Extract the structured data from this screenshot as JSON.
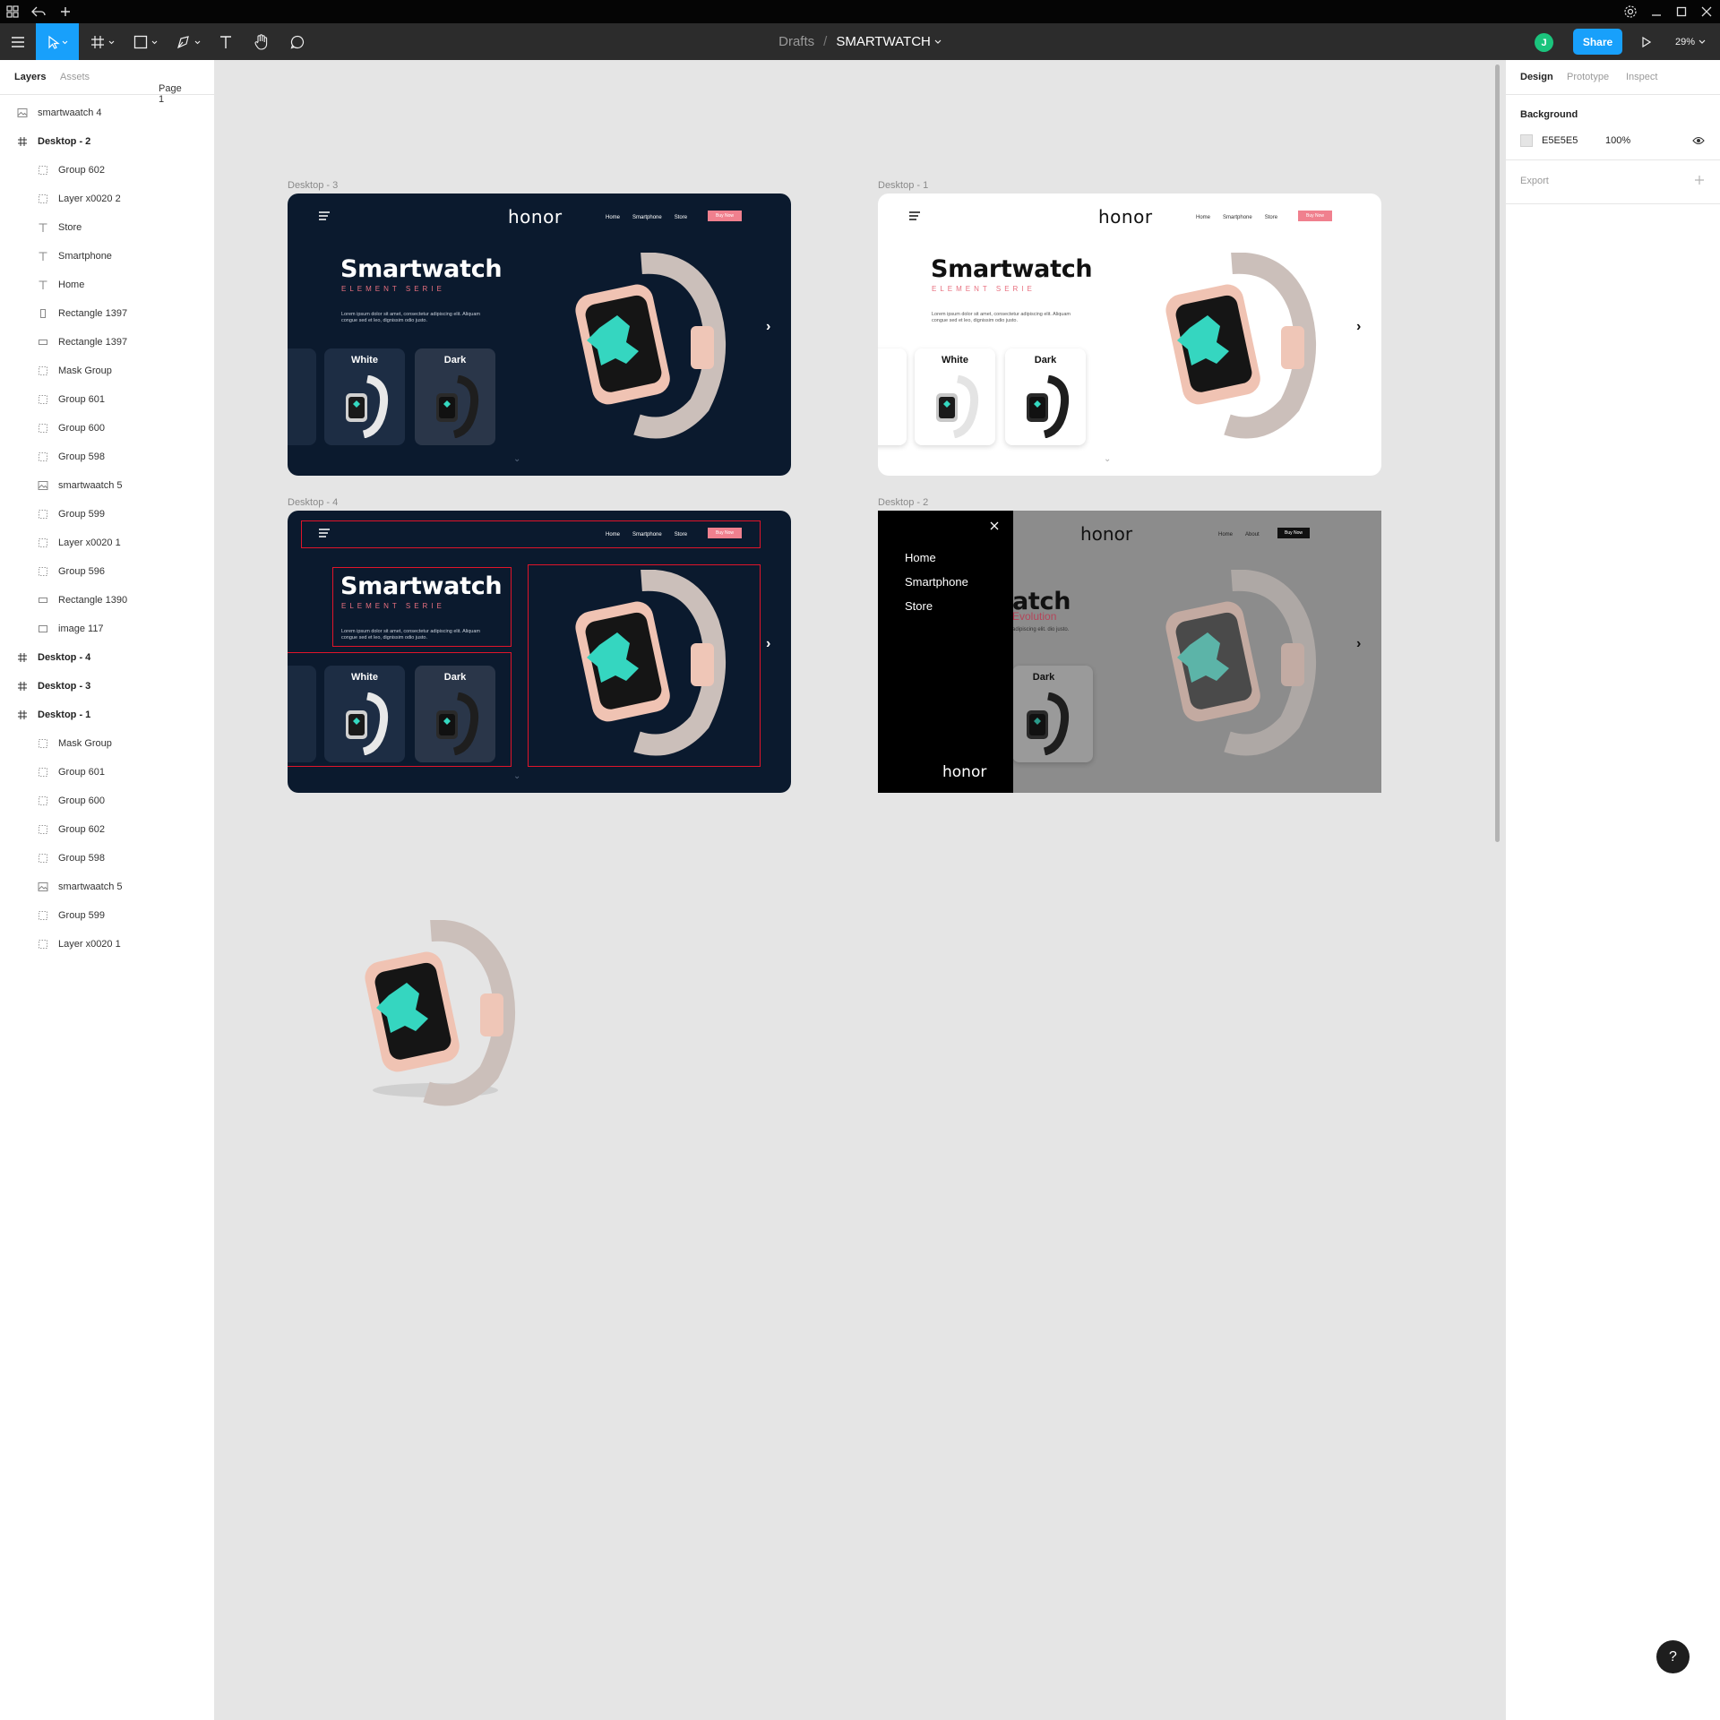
{
  "titlebar": {
    "icons": [
      "grid-icon",
      "undo-icon",
      "plus-icon"
    ],
    "window_controls": [
      "minimize-icon",
      "maximize-icon",
      "close-icon"
    ]
  },
  "toolbar": {
    "breadcrumb_parent": "Drafts",
    "separator": "/",
    "file_name": "SMARTWATCH",
    "avatar_initial": "J",
    "share_label": "Share",
    "zoom": "29%",
    "tools": [
      "menu-icon",
      "move-tool-icon",
      "frame-tool-icon",
      "shape-tool-icon",
      "pen-tool-icon",
      "text-tool-icon",
      "hand-tool-icon",
      "comment-tool-icon"
    ]
  },
  "left_panel": {
    "tab_layers": "Layers",
    "tab_assets": "Assets",
    "page_selector": "Page 1",
    "layers": [
      {
        "label": "smartwaatch 4",
        "icon": "image-icon",
        "depth": 1,
        "frame": false
      },
      {
        "label": "Desktop - 2",
        "icon": "frame-icon",
        "depth": 1,
        "frame": true
      },
      {
        "label": "Group 602",
        "icon": "group-icon",
        "depth": 2,
        "frame": false
      },
      {
        "label": "Layer x0020 2",
        "icon": "group-icon",
        "depth": 2,
        "frame": false
      },
      {
        "label": "Store",
        "icon": "text-icon",
        "depth": 2,
        "frame": false
      },
      {
        "label": "Smartphone",
        "icon": "text-icon",
        "depth": 2,
        "frame": false
      },
      {
        "label": "Home",
        "icon": "text-icon",
        "depth": 2,
        "frame": false
      },
      {
        "label": "Rectangle 1397",
        "icon": "rect-tall-icon",
        "depth": 2,
        "frame": false
      },
      {
        "label": "Rectangle 1397",
        "icon": "rect-wide-icon",
        "depth": 2,
        "frame": false
      },
      {
        "label": "Mask Group",
        "icon": "group-icon",
        "depth": 2,
        "frame": false
      },
      {
        "label": "Group 601",
        "icon": "group-icon",
        "depth": 2,
        "frame": false
      },
      {
        "label": "Group 600",
        "icon": "group-icon",
        "depth": 2,
        "frame": false
      },
      {
        "label": "Group 598",
        "icon": "group-icon",
        "depth": 2,
        "frame": false
      },
      {
        "label": "smartwaatch 5",
        "icon": "image-icon",
        "depth": 2,
        "frame": false
      },
      {
        "label": "Group 599",
        "icon": "group-icon",
        "depth": 2,
        "frame": false
      },
      {
        "label": "Layer x0020 1",
        "icon": "group-icon",
        "depth": 2,
        "frame": false
      },
      {
        "label": "Group 596",
        "icon": "group-icon",
        "depth": 2,
        "frame": false
      },
      {
        "label": "Rectangle 1390",
        "icon": "rect-wide-icon",
        "depth": 2,
        "frame": false
      },
      {
        "label": "image 117",
        "icon": "rect-icon",
        "depth": 2,
        "frame": false
      },
      {
        "label": "Desktop - 4",
        "icon": "frame-icon",
        "depth": 1,
        "frame": true
      },
      {
        "label": "Desktop - 3",
        "icon": "frame-icon",
        "depth": 1,
        "frame": true
      },
      {
        "label": "Desktop - 1",
        "icon": "frame-icon",
        "depth": 1,
        "frame": true
      },
      {
        "label": "Mask Group",
        "icon": "group-icon",
        "depth": 2,
        "frame": false
      },
      {
        "label": "Group 601",
        "icon": "group-icon",
        "depth": 2,
        "frame": false
      },
      {
        "label": "Group 600",
        "icon": "group-icon",
        "depth": 2,
        "frame": false
      },
      {
        "label": "Group 602",
        "icon": "group-icon",
        "depth": 2,
        "frame": false
      },
      {
        "label": "Group 598",
        "icon": "group-icon",
        "depth": 2,
        "frame": false
      },
      {
        "label": "smartwaatch 5",
        "icon": "image-icon",
        "depth": 2,
        "frame": false
      },
      {
        "label": "Group 599",
        "icon": "group-icon",
        "depth": 2,
        "frame": false
      },
      {
        "label": "Layer x0020 1",
        "icon": "group-icon",
        "depth": 2,
        "frame": false
      }
    ]
  },
  "right_panel": {
    "tab_design": "Design",
    "tab_prototype": "Prototype",
    "tab_inspect": "Inspect",
    "background_label": "Background",
    "bg_hex": "E5E5E5",
    "bg_opacity": "100%",
    "export_label": "Export"
  },
  "canvas": {
    "colors": {
      "dark_bg": "#0b1a2e",
      "light_bg": "#ffffff",
      "accent_pink": "#f0808e",
      "overlay": "#8c8c8c"
    },
    "frames": {
      "desktop3": {
        "label": "Desktop - 3",
        "logo": "honor",
        "nav": [
          "Home",
          "Smartphone",
          "Store"
        ],
        "cta": "Buy Now",
        "title": "Smartwatch",
        "subtitle": "ELEMENT SERIE",
        "desc": "Lorem ipsum dolor sit amet, consectetur adipiscing elit. Aliquam congue sed et leo, dignissim odio justo.",
        "cards": [
          "White",
          "Dark"
        ]
      },
      "desktop1": {
        "label": "Desktop - 1",
        "logo": "honor",
        "nav": [
          "Home",
          "Smartphone",
          "Store"
        ],
        "cta": "Buy Now",
        "title": "Smartwatch",
        "subtitle": "ELEMENT SERIE",
        "desc": "Lorem ipsum dolor sit amet, consectetur adipiscing elit. Aliquam congue sed et leo, dignissim odio justo.",
        "cards": [
          "White",
          "Dark"
        ]
      },
      "desktop4": {
        "label": "Desktop - 4",
        "nav": [
          "Home",
          "Smartphone",
          "Store"
        ],
        "cta": "Buy Now",
        "title": "Smartwatch",
        "subtitle": "ELEMENT SERIE",
        "desc": "Lorem ipsum dolor sit amet, consectetur adipiscing elit. Aliquam congue sed et leo, dignissim odio justo.",
        "cards": [
          "White",
          "Dark"
        ]
      },
      "desktop2": {
        "label": "Desktop - 2",
        "logo": "honor",
        "nav": [
          "Home",
          "About"
        ],
        "cta": "Buy Now",
        "title_partial": "atch",
        "subtitle_partial": "Evolution",
        "desc_partial": "adipiscing elit. dio justo.",
        "menu_items": [
          "Home",
          "Smartphone",
          "Store"
        ],
        "menu_logo": "honor",
        "card": "Dark"
      }
    }
  }
}
